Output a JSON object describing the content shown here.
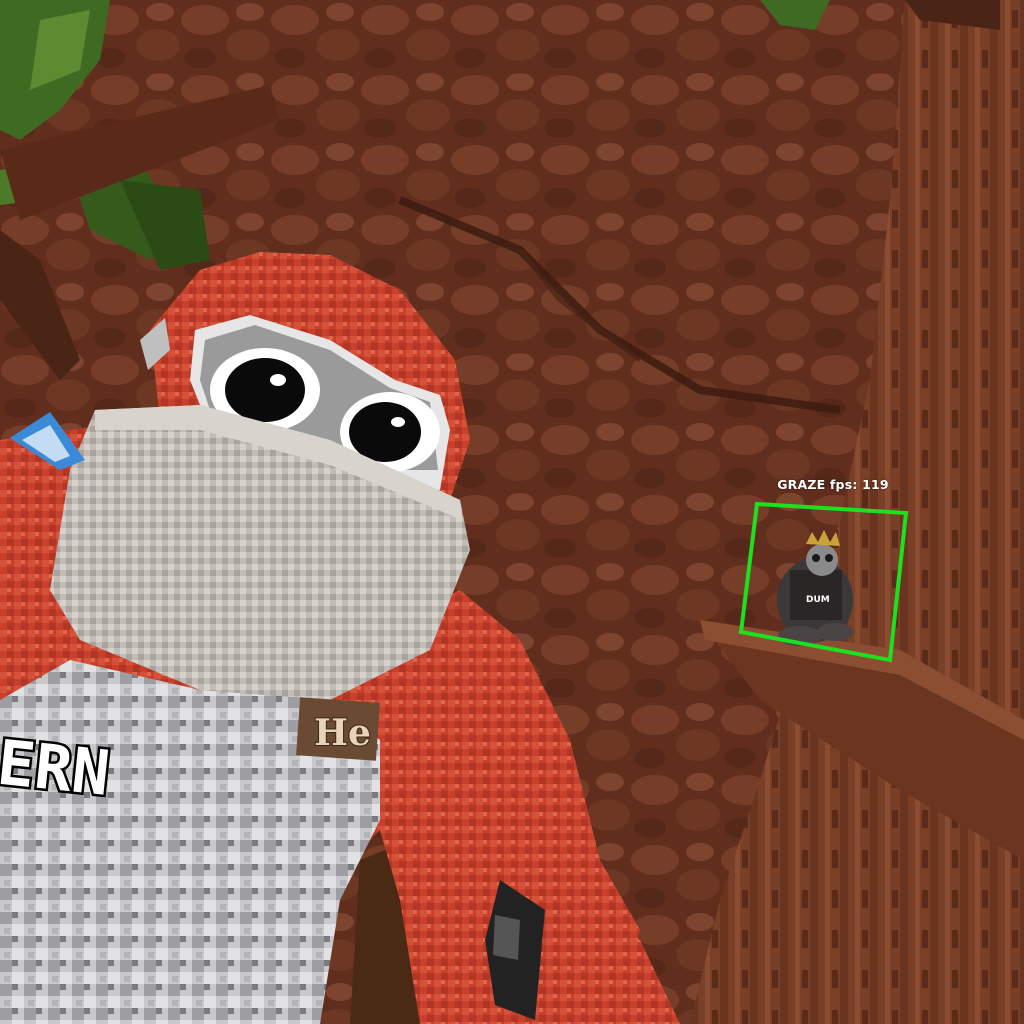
{
  "hud": {
    "target_name": "GRAZE",
    "fps_label": "fps:",
    "fps_value": "119",
    "box_color": "#1fe01f"
  },
  "player": {
    "shirt_text": "CERN",
    "badge_text": "He",
    "fur_color": "#c8402c",
    "mask_color": "#bdb7b1"
  },
  "other_player": {
    "shirt_text": "DUM"
  },
  "environment": {
    "bark_color": "#7a3f27",
    "leaf_color": "#3f6a22"
  }
}
